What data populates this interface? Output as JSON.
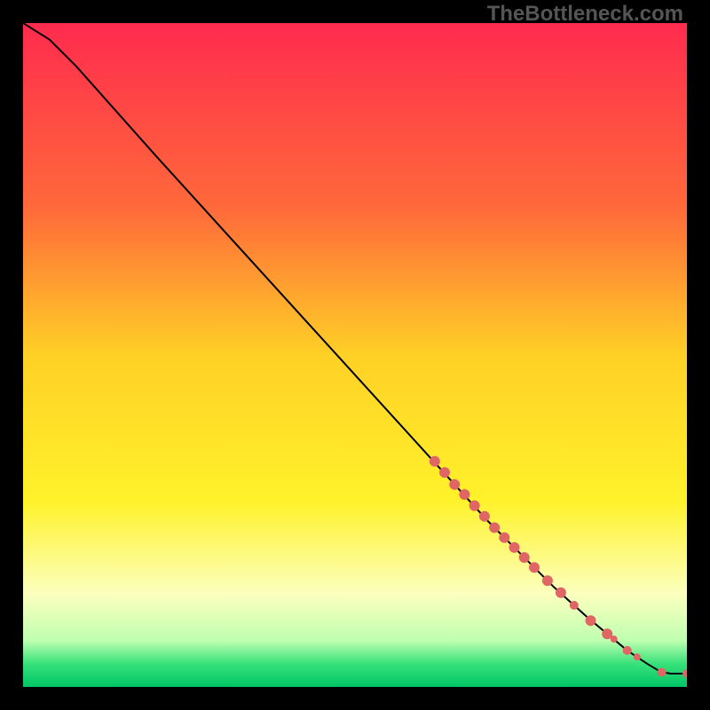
{
  "watermark": "TheBottleneck.com",
  "chart_data": {
    "type": "line",
    "title": "",
    "xlabel": "",
    "ylabel": "",
    "xlim": [
      0,
      100
    ],
    "ylim": [
      0,
      100
    ],
    "gradient_stops": [
      {
        "offset": 0,
        "color": "#ff2b4e"
      },
      {
        "offset": 0.28,
        "color": "#ff6a3a"
      },
      {
        "offset": 0.5,
        "color": "#ffd026"
      },
      {
        "offset": 0.72,
        "color": "#fff22a"
      },
      {
        "offset": 0.86,
        "color": "#fcffbe"
      },
      {
        "offset": 0.93,
        "color": "#bfffb0"
      },
      {
        "offset": 0.965,
        "color": "#38e27a"
      },
      {
        "offset": 1.0,
        "color": "#00c566"
      }
    ],
    "curve": [
      {
        "x": 0,
        "y": 100
      },
      {
        "x": 4,
        "y": 97.5
      },
      {
        "x": 8,
        "y": 93.5
      },
      {
        "x": 12,
        "y": 89
      },
      {
        "x": 20,
        "y": 80
      },
      {
        "x": 30,
        "y": 69
      },
      {
        "x": 40,
        "y": 58
      },
      {
        "x": 50,
        "y": 47
      },
      {
        "x": 60,
        "y": 36
      },
      {
        "x": 65,
        "y": 30.5
      },
      {
        "x": 70,
        "y": 25
      },
      {
        "x": 75,
        "y": 20
      },
      {
        "x": 80,
        "y": 15
      },
      {
        "x": 85,
        "y": 10.5
      },
      {
        "x": 88,
        "y": 8
      },
      {
        "x": 91,
        "y": 5.5
      },
      {
        "x": 94,
        "y": 3.5
      },
      {
        "x": 96,
        "y": 2.3
      },
      {
        "x": 97.5,
        "y": 2.0
      },
      {
        "x": 100,
        "y": 2.0
      }
    ],
    "markers": [
      {
        "x": 62.0,
        "y": 34.0,
        "r": 6
      },
      {
        "x": 63.5,
        "y": 32.3,
        "r": 6
      },
      {
        "x": 65.0,
        "y": 30.5,
        "r": 6
      },
      {
        "x": 66.5,
        "y": 29.0,
        "r": 6
      },
      {
        "x": 68.0,
        "y": 27.3,
        "r": 6
      },
      {
        "x": 69.5,
        "y": 25.7,
        "r": 6
      },
      {
        "x": 71.0,
        "y": 24.0,
        "r": 6
      },
      {
        "x": 72.5,
        "y": 22.5,
        "r": 6
      },
      {
        "x": 74.0,
        "y": 21.0,
        "r": 6
      },
      {
        "x": 75.5,
        "y": 19.5,
        "r": 6
      },
      {
        "x": 77.0,
        "y": 18.0,
        "r": 6
      },
      {
        "x": 79.0,
        "y": 16.0,
        "r": 6
      },
      {
        "x": 81.0,
        "y": 14.2,
        "r": 6
      },
      {
        "x": 83.0,
        "y": 12.3,
        "r": 5
      },
      {
        "x": 85.5,
        "y": 10.0,
        "r": 6
      },
      {
        "x": 88.0,
        "y": 8.0,
        "r": 6
      },
      {
        "x": 89.0,
        "y": 7.2,
        "r": 4
      },
      {
        "x": 91.0,
        "y": 5.5,
        "r": 5
      },
      {
        "x": 92.5,
        "y": 4.5,
        "r": 4
      },
      {
        "x": 96.2,
        "y": 2.2,
        "r": 5
      },
      {
        "x": 100.0,
        "y": 2.0,
        "r": 5
      }
    ],
    "marker_color": "#e06666",
    "line_color": "#000000"
  }
}
